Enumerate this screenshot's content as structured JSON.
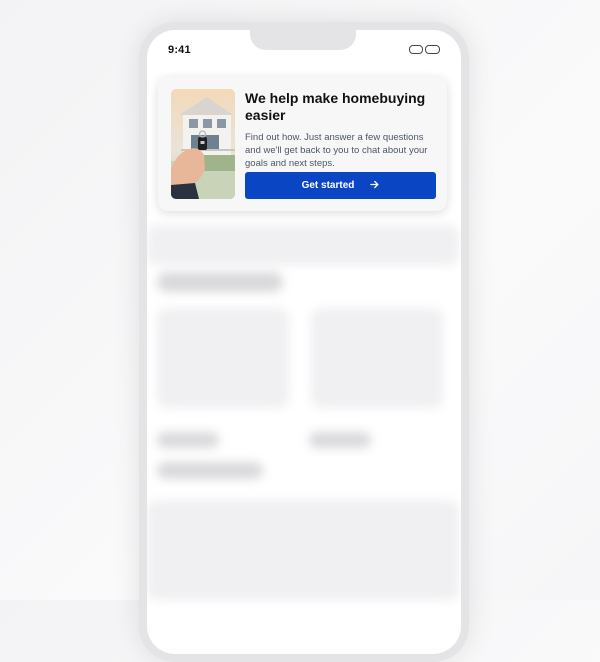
{
  "status_bar": {
    "time": "9:41"
  },
  "promo_card": {
    "title": "We help make homebuying easier",
    "description": "Find out how. Just answer a few questions and we'll get back to you to chat about your goals and next steps.",
    "cta_label": "Get started",
    "cta_icon": "arrow-right-icon",
    "image": "house-keys-photo",
    "accent_color": "#0a46c4"
  }
}
